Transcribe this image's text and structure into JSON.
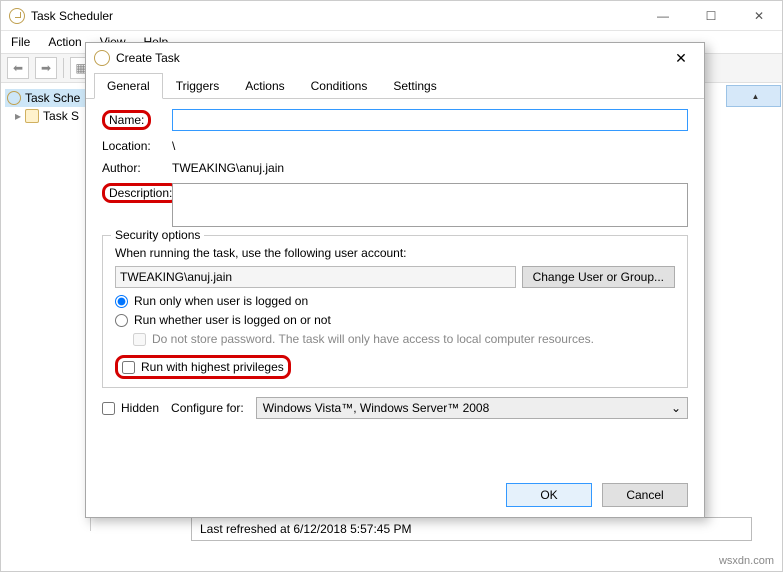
{
  "window": {
    "title": "Task Scheduler",
    "menu": [
      "File",
      "Action",
      "View",
      "Help"
    ]
  },
  "tree": {
    "items": [
      {
        "label": "Task Scheduler",
        "truncated": "Task Sche"
      },
      {
        "label": "Task Scheduler Library",
        "truncated": "Task S"
      }
    ]
  },
  "status": {
    "text": "Last refreshed at 6/12/2018 5:57:45 PM"
  },
  "dialog": {
    "title": "Create Task",
    "tabs": [
      "General",
      "Triggers",
      "Actions",
      "Conditions",
      "Settings"
    ],
    "active_tab": 0,
    "name_label": "Name:",
    "name_value": "",
    "location_label": "Location:",
    "location_value": "\\",
    "author_label": "Author:",
    "author_value": "TWEAKING\\anuj.jain",
    "description_label": "Description:",
    "description_value": "",
    "security": {
      "legend": "Security options",
      "prompt": "When running the task, use the following user account:",
      "account": "TWEAKING\\anuj.jain",
      "change_btn": "Change User or Group...",
      "radio_logged_on": "Run only when user is logged on",
      "radio_whether": "Run whether user is logged on or not",
      "no_store": "Do not store password. The task will only have access to local computer resources.",
      "highest": "Run with highest privileges"
    },
    "hidden_label": "Hidden",
    "configure_label": "Configure for:",
    "configure_value": "Windows Vista™, Windows Server™ 2008",
    "ok": "OK",
    "cancel": "Cancel"
  },
  "watermark": "wsxdn.com"
}
